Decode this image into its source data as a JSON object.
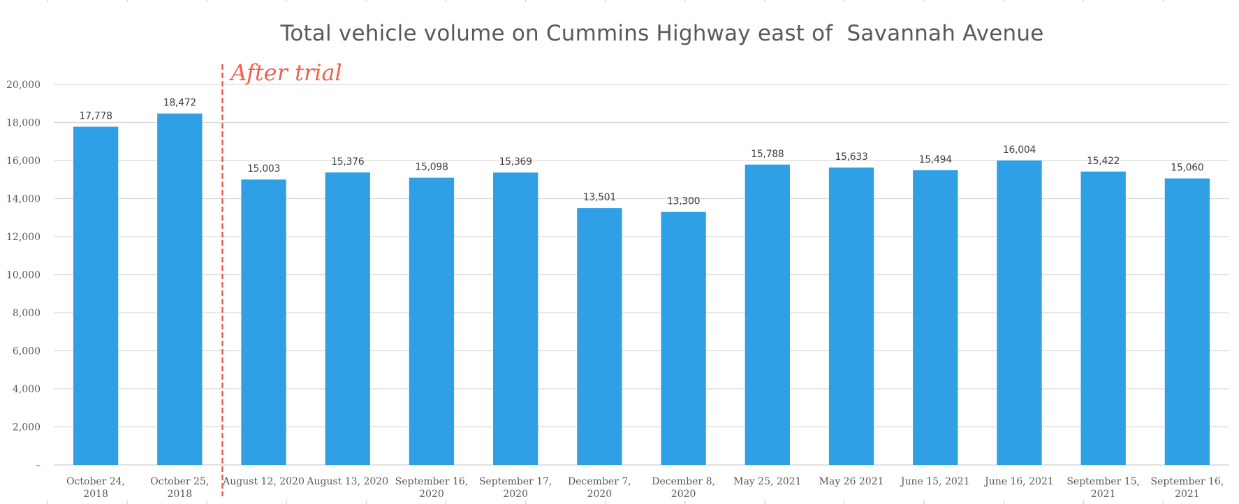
{
  "chart_data": {
    "type": "bar",
    "title": "Total vehicle volume on Cummins Highway east of  Savannah Avenue",
    "xlabel": "",
    "ylabel": "",
    "ylim": [
      0,
      20000
    ],
    "yticks": [
      0,
      2000,
      4000,
      6000,
      8000,
      10000,
      12000,
      14000,
      16000,
      18000,
      20000
    ],
    "ytick_labels": [
      "–",
      "2,000",
      "4,000",
      "6,000",
      "8,000",
      "10,000",
      "12,000",
      "14,000",
      "16,000",
      "18,000",
      "20,000"
    ],
    "grid": true,
    "legend": "none",
    "categories": [
      [
        "October 24,",
        "2018"
      ],
      [
        "October 25,",
        "2018"
      ],
      [
        "August 12, 2020"
      ],
      [
        "August 13, 2020"
      ],
      [
        "September 16,",
        "2020"
      ],
      [
        "September 17,",
        "2020"
      ],
      [
        "December 7,",
        "2020"
      ],
      [
        "December 8,",
        "2020"
      ],
      [
        "May 25, 2021"
      ],
      [
        "May 26 2021"
      ],
      [
        "June 15, 2021"
      ],
      [
        "June 16, 2021"
      ],
      [
        "September 15,",
        "2021"
      ],
      [
        "September 16,",
        "2021"
      ]
    ],
    "values": [
      17778,
      18472,
      15003,
      15376,
      15098,
      15369,
      13501,
      13300,
      15788,
      15633,
      15494,
      16004,
      15422,
      15060
    ],
    "data_labels": [
      "17,778",
      "18,472",
      "15,003",
      "15,376",
      "15,098",
      "15,369",
      "13,501",
      "13,300",
      "15,788",
      "15,633",
      "15,494",
      "16,004",
      "15,422",
      "15,060"
    ],
    "series_color": "#2f9fe6",
    "annotations": [
      {
        "type": "vertical-divider",
        "after_category_index": 1,
        "label": "After trial",
        "color": "#f2604e",
        "style": "dashed"
      }
    ]
  }
}
